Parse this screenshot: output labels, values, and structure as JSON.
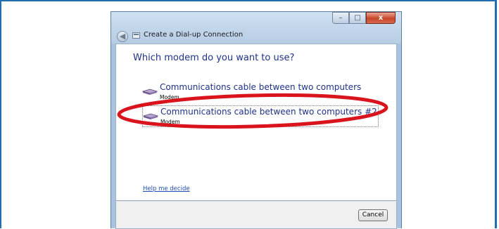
{
  "window": {
    "title": "Create a Dial-up Connection",
    "controls": {
      "minimize": "–",
      "maximize": "□",
      "close": "x"
    }
  },
  "main": {
    "heading": "Which modem do you want to use?",
    "modems": [
      {
        "name": "Communications cable between two computers",
        "type": "Modem"
      },
      {
        "name": "Communications cable between two computers #2",
        "type": "Modem"
      }
    ],
    "help_link": "Help me decide"
  },
  "footer": {
    "cancel_label": "Cancel"
  },
  "highlight": {
    "color": "#d9141d"
  }
}
